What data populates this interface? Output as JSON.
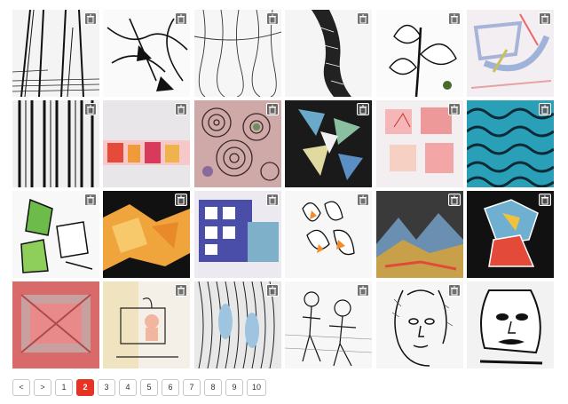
{
  "gallery": {
    "tiles": [
      {
        "icon": "trash-icon"
      },
      {
        "icon": "trash-icon"
      },
      {
        "icon": "trash-icon"
      },
      {
        "icon": "trash-icon"
      },
      {
        "icon": "trash-icon"
      },
      {
        "icon": "trash-icon"
      },
      {
        "icon": "trash-icon"
      },
      {
        "icon": "trash-icon"
      },
      {
        "icon": "trash-icon"
      },
      {
        "icon": "trash-icon"
      },
      {
        "icon": "trash-icon"
      },
      {
        "icon": "trash-icon"
      },
      {
        "icon": "trash-icon"
      },
      {
        "icon": "trash-icon"
      },
      {
        "icon": "trash-icon"
      },
      {
        "icon": "trash-icon"
      },
      {
        "icon": "trash-icon"
      },
      {
        "icon": "trash-icon"
      },
      {
        "icon": "trash-icon"
      },
      {
        "icon": "trash-icon"
      },
      {
        "icon": "trash-icon"
      },
      {
        "icon": "trash-icon"
      },
      {
        "icon": "trash-icon"
      },
      {
        "icon": "trash-icon"
      }
    ]
  },
  "pagination": {
    "prev": "<",
    "next": ">",
    "pages": [
      "1",
      "2",
      "3",
      "4",
      "5",
      "6",
      "7",
      "8",
      "9",
      "10"
    ],
    "current": "2",
    "active_color": "#e53324"
  }
}
